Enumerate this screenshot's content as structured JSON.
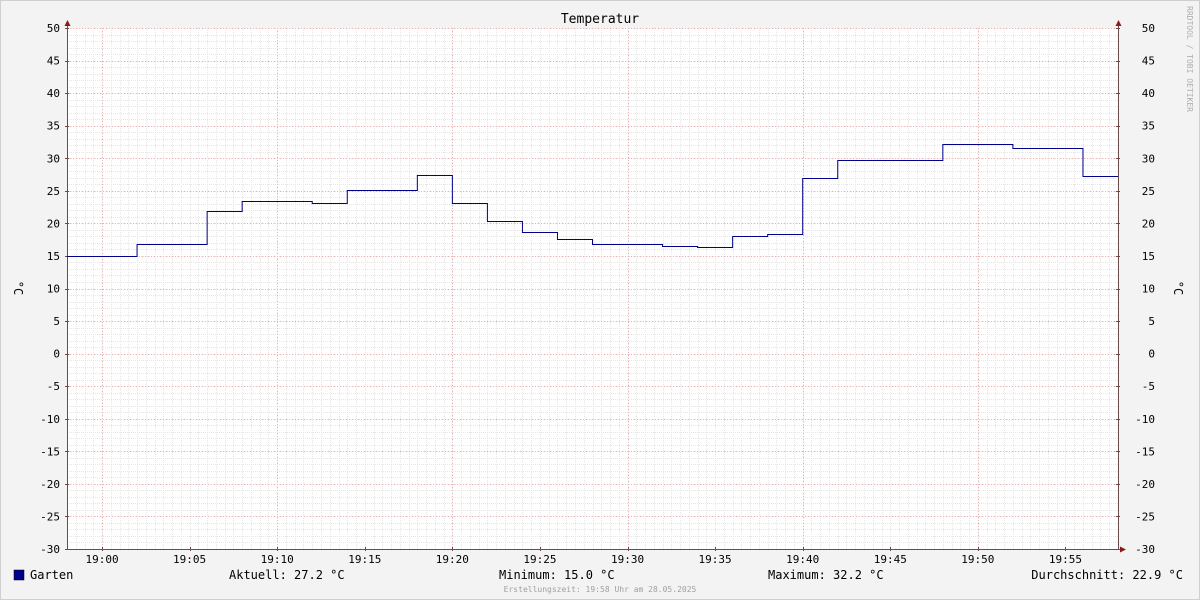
{
  "chart_data": {
    "type": "line",
    "title": "Temperatur",
    "ylabel_left": "°C",
    "ylabel_right": "°C",
    "watermark": "RRDTOOL / TOBI OETIKER",
    "ylim": [
      -30,
      50
    ],
    "y_ticks": [
      50,
      45,
      40,
      35,
      30,
      25,
      20,
      15,
      10,
      5,
      0,
      -5,
      -10,
      -15,
      -20,
      -25,
      -30
    ],
    "x_range_min": [
      -2,
      58
    ],
    "x_ticks": [
      {
        "t": 0,
        "label": "19:00"
      },
      {
        "t": 5,
        "label": "19:05"
      },
      {
        "t": 10,
        "label": "19:10"
      },
      {
        "t": 15,
        "label": "19:15"
      },
      {
        "t": 20,
        "label": "19:20"
      },
      {
        "t": 25,
        "label": "19:25"
      },
      {
        "t": 30,
        "label": "19:30"
      },
      {
        "t": 35,
        "label": "19:35"
      },
      {
        "t": 40,
        "label": "19:40"
      },
      {
        "t": 45,
        "label": "19:45"
      },
      {
        "t": 50,
        "label": "19:50"
      },
      {
        "t": 55,
        "label": "19:55"
      }
    ],
    "series": [
      {
        "name": "Garten",
        "color": "#00008b",
        "steps": [
          {
            "t": -2,
            "v": 15.0
          },
          {
            "t": 2,
            "v": 16.8
          },
          {
            "t": 6,
            "v": 21.9
          },
          {
            "t": 8,
            "v": 23.4
          },
          {
            "t": 12,
            "v": 23.1
          },
          {
            "t": 14,
            "v": 25.2
          },
          {
            "t": 18,
            "v": 27.4
          },
          {
            "t": 20,
            "v": 23.1
          },
          {
            "t": 22,
            "v": 20.3
          },
          {
            "t": 24,
            "v": 18.6
          },
          {
            "t": 26,
            "v": 17.6
          },
          {
            "t": 28,
            "v": 16.9
          },
          {
            "t": 32,
            "v": 16.6
          },
          {
            "t": 34,
            "v": 16.4
          },
          {
            "t": 36,
            "v": 18.1
          },
          {
            "t": 38,
            "v": 18.3
          },
          {
            "t": 40,
            "v": 27.0
          },
          {
            "t": 42,
            "v": 29.7
          },
          {
            "t": 48,
            "v": 32.2
          },
          {
            "t": 52,
            "v": 31.5
          },
          {
            "t": 56,
            "v": 27.2
          },
          {
            "t": 58,
            "v": 27.2
          }
        ]
      }
    ],
    "colors": {
      "background": "#f3f3f3",
      "canvas": "#ffffff",
      "grid_minor": "#e6e6e6",
      "grid_major": "#f0b0b0",
      "axis": "#6e4b4b",
      "arrow": "#8b1a1a",
      "text": "#000000",
      "watermark": "#b0b0b0",
      "footer_note": "#a0a0a0"
    }
  },
  "legend": {
    "series_name": "Garten",
    "series_color": "#00008b",
    "current": "Aktuell: 27.2 °C",
    "minimum": "Minimum: 15.0 °C",
    "maximum": "Maximum: 32.2 °C",
    "average": "Durchschnitt: 22.9 °C"
  },
  "footer": {
    "created": "Erstellungszeit: 19:58 Uhr am 28.05.2025"
  }
}
